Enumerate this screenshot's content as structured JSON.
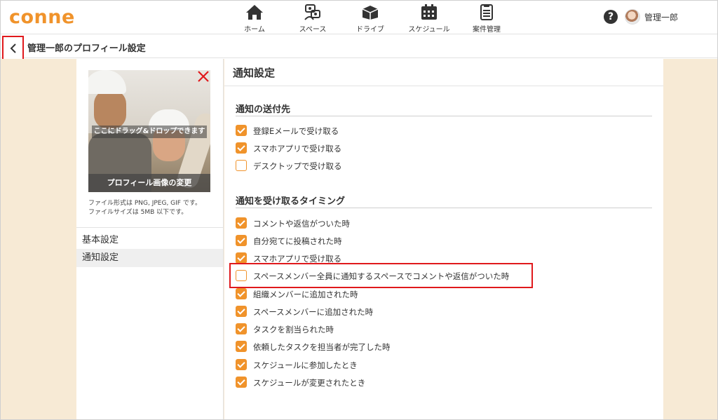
{
  "app": {
    "logo": "conne"
  },
  "nav": [
    {
      "label": "ホーム",
      "icon": "home-icon"
    },
    {
      "label": "スペース",
      "icon": "space-icon"
    },
    {
      "label": "ドライブ",
      "icon": "drive-icon"
    },
    {
      "label": "スケジュール",
      "icon": "calendar-icon"
    },
    {
      "label": "案件管理",
      "icon": "document-icon"
    }
  ],
  "header": {
    "help": "?",
    "user_name": "管理一郎"
  },
  "titlebar": {
    "title": "管理一郎のプロフィール設定"
  },
  "profile": {
    "drop_label": "ここにドラッグ&ドロップできます",
    "change_label": "プロフィール画像の変更",
    "file_note_1": "ファイル形式は PNG, JPEG, GIF です。",
    "file_note_2": "ファイルサイズは 5MB 以下です。"
  },
  "side_menu": [
    {
      "label": "基本設定",
      "active": false
    },
    {
      "label": "通知設定",
      "active": true
    }
  ],
  "settings": {
    "title": "通知設定",
    "destination": {
      "heading": "通知の送付先",
      "options": [
        {
          "label": "登録Eメールで受け取る",
          "checked": true
        },
        {
          "label": "スマホアプリで受け取る",
          "checked": true
        },
        {
          "label": "デスクトップで受け取る",
          "checked": false
        }
      ]
    },
    "timing": {
      "heading": "通知を受け取るタイミング",
      "options": [
        {
          "label": "コメントや返信がついた時",
          "checked": true
        },
        {
          "label": "自分宛てに投稿された時",
          "checked": true
        },
        {
          "label": "スマホアプリで受け取る",
          "checked": true
        },
        {
          "label": "スペースメンバー全員に通知するスペースでコメントや返信がついた時",
          "checked": false
        },
        {
          "label": "組織メンバーに追加された時",
          "checked": true
        },
        {
          "label": "スペースメンバーに追加された時",
          "checked": true
        },
        {
          "label": "タスクを割当られた時",
          "checked": true
        },
        {
          "label": "依頼したタスクを担当者が完了した時",
          "checked": true
        },
        {
          "label": "スケジュールに参加したとき",
          "checked": true
        },
        {
          "label": "スケジュールが変更されたとき",
          "checked": true
        }
      ]
    }
  },
  "colors": {
    "accent": "#f0932b",
    "highlight": "#e0191c",
    "background": "#f7ead5"
  }
}
